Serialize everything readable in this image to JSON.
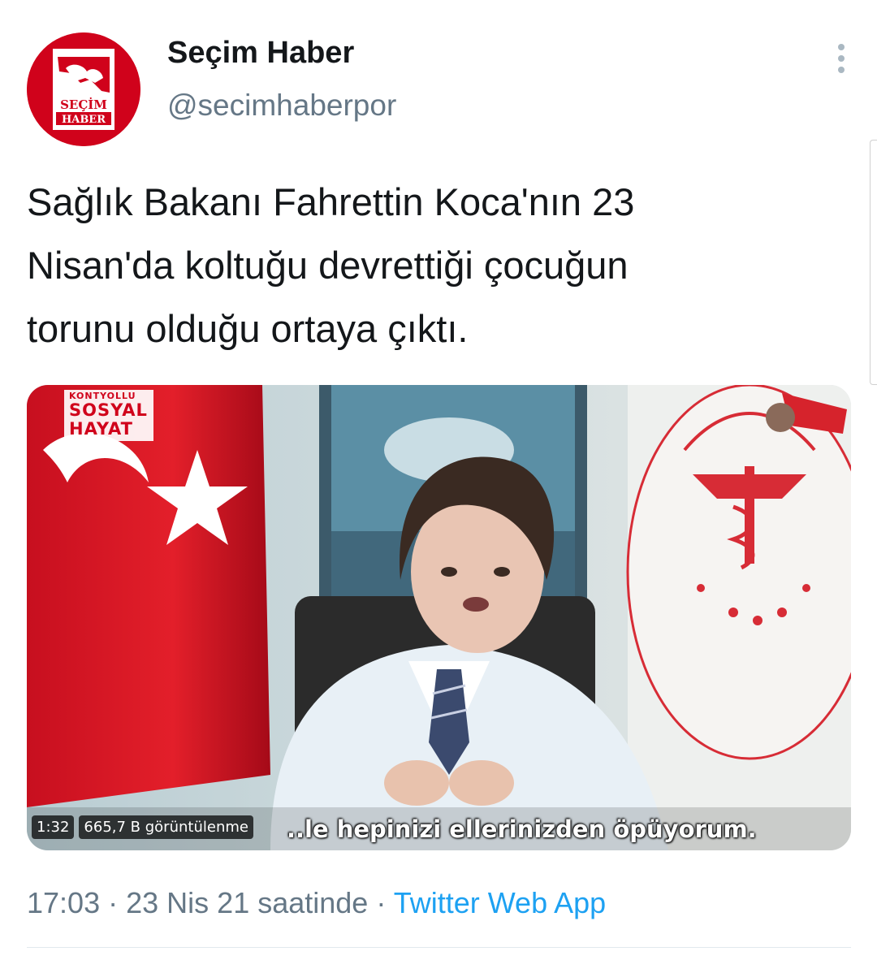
{
  "account": {
    "display_name": "Seçim Haber",
    "handle": "@secimhaberpor",
    "avatar_logo_text": [
      "SEÇİM",
      "HABER"
    ]
  },
  "tweet": {
    "text_lines": [
      "Sağlık Bakanı Fahrettin Koca'nın 23",
      "Nisan'da koltuğu devrettiği çocuğun",
      "torunu olduğu ortaya çıktı."
    ],
    "time": "17:03",
    "date": "23 Nis 21 saatinde",
    "separator": "·",
    "source": "Twitter Web App"
  },
  "media": {
    "watermark_small": "KONTYOLLU",
    "watermark_line1": "SOSYAL",
    "watermark_line2": "HAYAT",
    "duration": "1:32",
    "views": "665,7 B görüntülenme",
    "subtitle": "..le hepinizi ellerinizden öpüyorum."
  },
  "colors": {
    "brand_red": "#d0021b",
    "link_blue": "#1da1f2",
    "secondary_text": "#657786",
    "primary_text": "#14171a"
  },
  "icons": {
    "more": "vertical-ellipsis-icon"
  }
}
